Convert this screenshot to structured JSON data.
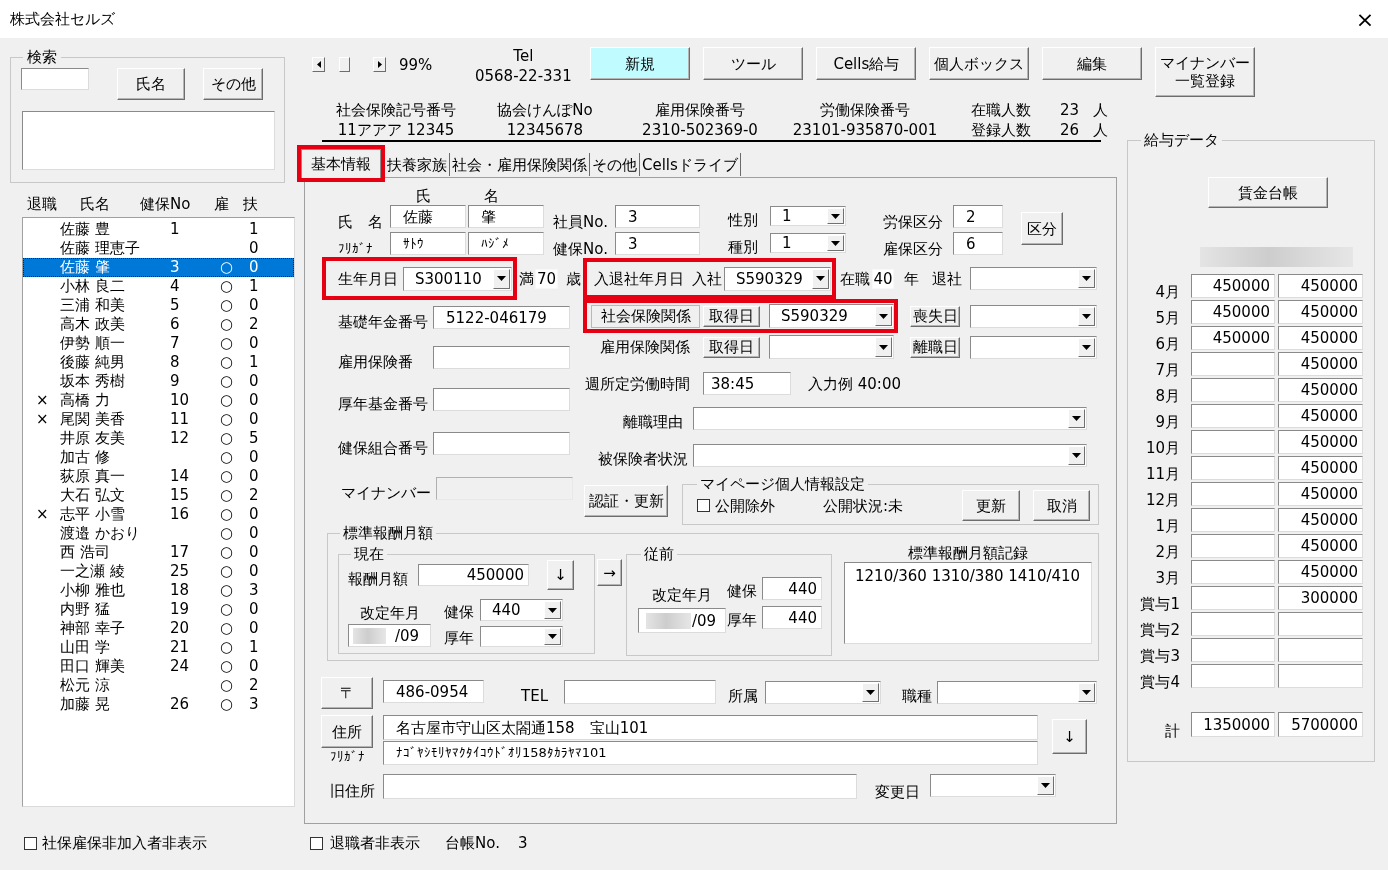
{
  "window": {
    "title": "株式会社セルズ",
    "close": "×"
  },
  "search": {
    "legend": "検索",
    "buttons": [
      "氏名",
      "その他"
    ]
  },
  "employee_list": {
    "columns": [
      "退職",
      "氏名",
      "健保No",
      "雇",
      "扶"
    ],
    "rows": [
      {
        "name": "佐藤 豊",
        "kenpo_no": "1",
        "dependents": "1",
        "selected": false
      },
      {
        "name": "佐藤 理恵子",
        "dependents": "0",
        "selected": false
      },
      {
        "name": "佐藤 肇",
        "kenpo_no": "3",
        "employment": "○",
        "dependents": "0",
        "selected": true
      },
      {
        "name": "小林 良二",
        "kenpo_no": "4",
        "employment": "○",
        "dependents": "1",
        "selected": false
      },
      {
        "name": "三浦 和美",
        "kenpo_no": "5",
        "employment": "○",
        "dependents": "0",
        "selected": false
      },
      {
        "name": "高木 政美",
        "kenpo_no": "6",
        "employment": "○",
        "dependents": "2",
        "selected": false
      },
      {
        "name": "伊勢 順一",
        "kenpo_no": "7",
        "employment": "○",
        "dependents": "0",
        "selected": false
      },
      {
        "name": "後藤 純男",
        "kenpo_no": "8",
        "employment": "○",
        "dependents": "1",
        "selected": false
      },
      {
        "name": "坂本 秀樹",
        "kenpo_no": "9",
        "employment": "○",
        "dependents": "0",
        "selected": false
      },
      {
        "retired": "×",
        "name": "高橋 力",
        "kenpo_no": "10",
        "employment": "○",
        "dependents": "0",
        "selected": false
      },
      {
        "retired": "×",
        "name": "尾関 美香",
        "kenpo_no": "11",
        "employment": "○",
        "dependents": "0",
        "selected": false
      },
      {
        "name": "井原 友美",
        "kenpo_no": "12",
        "employment": "○",
        "dependents": "5",
        "selected": false
      },
      {
        "name": "加古 修",
        "employment": "○",
        "dependents": "0",
        "selected": false
      },
      {
        "name": "荻原 真一",
        "kenpo_no": "14",
        "employment": "○",
        "dependents": "0",
        "selected": false
      },
      {
        "name": "大石 弘文",
        "kenpo_no": "15",
        "employment": "○",
        "dependents": "2",
        "selected": false
      },
      {
        "retired": "×",
        "name": "志平 小雪",
        "kenpo_no": "16",
        "employment": "○",
        "dependents": "0",
        "selected": false
      },
      {
        "name": "渡邉 かおり",
        "employment": "○",
        "dependents": "0",
        "selected": false
      },
      {
        "name": "西 浩司",
        "kenpo_no": "17",
        "employment": "○",
        "dependents": "0",
        "selected": false
      },
      {
        "name": "一之瀬 綾",
        "kenpo_no": "25",
        "employment": "○",
        "dependents": "0",
        "selected": false
      },
      {
        "name": "小柳 雅也",
        "kenpo_no": "18",
        "employment": "○",
        "dependents": "3",
        "selected": false
      },
      {
        "name": "内野 猛",
        "kenpo_no": "19",
        "employment": "○",
        "dependents": "0",
        "selected": false
      },
      {
        "name": "神部 幸子",
        "kenpo_no": "20",
        "employment": "○",
        "dependents": "0",
        "selected": false
      },
      {
        "name": "山田 学",
        "kenpo_no": "21",
        "employment": "○",
        "dependents": "1",
        "selected": false
      },
      {
        "name": "田口 輝美",
        "kenpo_no": "24",
        "employment": "○",
        "dependents": "0",
        "selected": false
      },
      {
        "name": "松元 涼",
        "employment": "○",
        "dependents": "2",
        "selected": false
      },
      {
        "name": "加藤 晃",
        "kenpo_no": "26",
        "employment": "○",
        "dependents": "3",
        "selected": false
      }
    ]
  },
  "hide_uninsured": {
    "label": "社保雇保非加入者非表示",
    "checked": false
  },
  "zoom": {
    "value": "99%"
  },
  "tel": {
    "label": "Tel",
    "value": "0568-22-331"
  },
  "toolbar": [
    {
      "label": "新規",
      "highlighted": true
    },
    {
      "label": "ツール",
      "highlighted": false
    },
    {
      "label": "Cells給与",
      "highlighted": false
    },
    {
      "label": "個人ボックス",
      "highlighted": false
    },
    {
      "label": "編集",
      "highlighted": false
    },
    {
      "label": "マイナンバー一覧登録",
      "highlighted": false
    }
  ],
  "insurance_numbers": [
    {
      "label": "社会保険記号番号",
      "value": "11アアア 12345"
    },
    {
      "label": "協会けんぽNo",
      "value": "12345678"
    },
    {
      "label": "雇用保険番号",
      "value": "2310-502369-0"
    },
    {
      "label": "労働保険番号",
      "value": "23101-935870-001"
    }
  ],
  "headcounts": [
    {
      "label": "在職人数",
      "value": "23",
      "unit": "人"
    },
    {
      "label": "登録人数",
      "value": "26",
      "unit": "人"
    }
  ],
  "tabs": [
    {
      "label": "基本情報",
      "selected": true,
      "highlighted": true
    },
    {
      "label": "扶養家族",
      "selected": false,
      "highlighted": false
    },
    {
      "label": "社会・雇用保険関係",
      "selected": false,
      "highlighted": false
    },
    {
      "label": "その他",
      "selected": false,
      "highlighted": false
    },
    {
      "label": "Cellsドライブ",
      "selected": false,
      "highlighted": false
    }
  ],
  "basic_info": {
    "name": {
      "label": "氏　名",
      "surname_heading": "氏",
      "given_heading": "名",
      "surname": "佐藤",
      "given": "肇"
    },
    "furigana": {
      "label": "ﾌﾘｶﾞﾅ",
      "surname": "ｻﾄｳ",
      "given": "ﾊｼﾞﾒ"
    },
    "employee_no": {
      "label": "社員No.",
      "value": "3"
    },
    "kenpo_no": {
      "label": "健保No.",
      "value": "3"
    },
    "gender": {
      "label": "性別",
      "value": "1"
    },
    "category": {
      "label": "種別",
      "value": "1"
    },
    "labor_insurance_class": {
      "label": "労保区分",
      "value": "2"
    },
    "employment_insurance_class": {
      "label": "雇保区分",
      "value": "6"
    },
    "class_button": "区分",
    "birth_date": {
      "label": "生年月日",
      "value": "S300110",
      "highlighted": true
    },
    "age": {
      "prefix": "満",
      "value": "70",
      "unit": "歳"
    },
    "hire_date": {
      "label": "入退社年月日",
      "sub_label": "入社",
      "value": "S590329",
      "highlighted": true
    },
    "tenure": {
      "label": "在職",
      "value": "40",
      "unit": "年"
    },
    "leave_date": {
      "label": "退社"
    },
    "pension_no": {
      "label": "基礎年金番号",
      "value": "5122-046179"
    },
    "employment_insurance_no": {
      "label": "雇用保険番"
    },
    "pension_fund_no": {
      "label": "厚年基金番号"
    },
    "health_union_no": {
      "label": "健保組合番号"
    },
    "my_number": {
      "label": "マイナンバー",
      "disabled": true
    },
    "social_insurance": {
      "label": "社会保険関係",
      "acquired_button": "取得日",
      "acquired_date": "S590329",
      "lost_button": "喪失日",
      "highlighted": true
    },
    "employment_insurance": {
      "label": "雇用保険関係",
      "acquired_button": "取得日",
      "lost_button": "離職日"
    },
    "weekly_hours": {
      "label": "週所定労働時間",
      "value": "38:45",
      "hint": "入力例 40:00"
    },
    "separation_reason": {
      "label": "離職理由"
    },
    "insured_status": {
      "label": "被保険者状況"
    },
    "auth_button": "認証・更新",
    "mypage": {
      "legend": "マイページ個人情報設定",
      "exclude": {
        "label": "公開除外",
        "checked": false
      },
      "status": "公開状況:未",
      "buttons": [
        "更新",
        "取消"
      ]
    },
    "standard_pay": {
      "legend": "標準報酬月額",
      "current": {
        "legend": "現在",
        "pay_label": "報酬月額",
        "pay": "450000",
        "down_button": "↓",
        "revision_label": "改定年月",
        "revision": "/09",
        "redacted": true,
        "kenpo_label": "健保",
        "kenpo": "440",
        "kounen_label": "厚年"
      },
      "copy_button": "→",
      "previous": {
        "legend": "従前",
        "revision_label": "改定年月",
        "revision": "/09",
        "redacted": true,
        "kenpo_label": "健保",
        "kenpo": "440",
        "kounen_label": "厚年",
        "kounen": "440"
      },
      "history": {
        "label": "標準報酬月額記録",
        "value": "1210/360 1310/380 1410/410"
      }
    },
    "address": {
      "zip_button": "〒",
      "zip": "486-0954",
      "tel_label": "TEL",
      "department_label": "所属",
      "job_label": "職種",
      "address_button": "住所",
      "address": "名古屋市守山区太閤通158　宝山101",
      "furigana_label": "ﾌﾘｶﾞﾅ",
      "furigana": "ﾅｺﾞﾔｼﾓﾘﾔﾏｸﾀｲｺｳﾄﾞｵﾘ158ﾀｶﾗﾔﾏ101",
      "copy_button": "↓",
      "old_address_label": "旧住所",
      "change_date_label": "変更日"
    }
  },
  "hide_retired": {
    "label": "退職者非表示",
    "checked": false
  },
  "ledger_no": {
    "label": "台帳No.",
    "value": "3"
  },
  "salary_data": {
    "legend": "給与データ",
    "button": "賃金台帳",
    "header_redacted": true,
    "rows": [
      {
        "label": "4月",
        "col_1": "450000",
        "col_2": "450000"
      },
      {
        "label": "5月",
        "col_1": "450000",
        "col_2": "450000"
      },
      {
        "label": "6月",
        "col_1": "450000",
        "col_2": "450000"
      },
      {
        "label": "7月",
        "col_2": "450000"
      },
      {
        "label": "8月",
        "col_2": "450000"
      },
      {
        "label": "9月",
        "col_2": "450000"
      },
      {
        "label": "10月",
        "col_2": "450000"
      },
      {
        "label": "11月",
        "col_2": "450000"
      },
      {
        "label": "12月",
        "col_2": "450000"
      },
      {
        "label": "1月",
        "col_2": "450000"
      },
      {
        "label": "2月",
        "col_2": "450000"
      },
      {
        "label": "3月",
        "col_2": "450000"
      },
      {
        "label": "賞与1",
        "col_2": "300000"
      },
      {
        "label": "賞与2"
      },
      {
        "label": "賞与3"
      },
      {
        "label": "賞与4"
      }
    ],
    "total": {
      "label": "計",
      "col_1": "1350000",
      "col_2": "5700000"
    }
  }
}
